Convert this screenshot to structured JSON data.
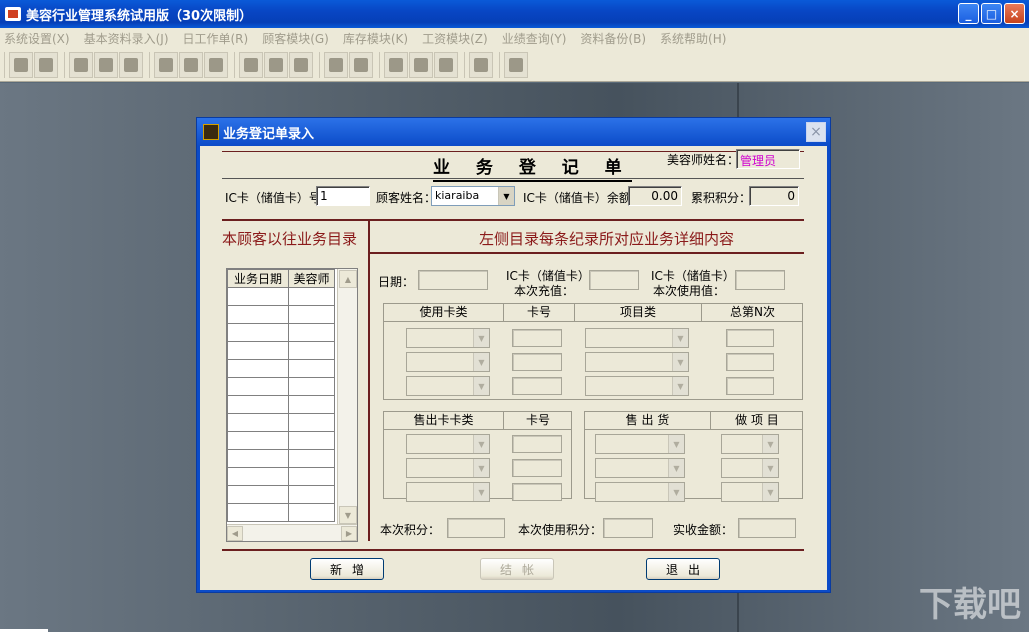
{
  "window": {
    "title": "美容行业管理系统试用版（30次限制）",
    "buttons": {
      "minimize": "_",
      "maximize": "□",
      "close": "×"
    }
  },
  "menu": [
    "系统设置(X)",
    "基本资料录入(J)",
    "日工作单(R)",
    "顾客模块(G)",
    "库存模块(K)",
    "工资模块(Z)",
    "业绩查询(Y)",
    "资料备份(B)",
    "系统帮助(H)"
  ],
  "toolbar_icons": [
    [
      "exit-icon",
      "lock-icon"
    ],
    [
      "handshake-icon",
      "edit-form-icon",
      "notebook-icon"
    ],
    [
      "binoculars-icon",
      "image-icon",
      "report-icon"
    ],
    [
      "transfer-icon",
      "register-icon",
      "keyboard-icon"
    ],
    [
      "card-icon",
      "ledger-icon"
    ],
    [
      "chart-icon",
      "calc-icon",
      "exchange-icon"
    ],
    [
      "phone-icon"
    ],
    [
      "tools-icon"
    ]
  ],
  "watermark": "下载吧",
  "dialog": {
    "title": "业务登记单录入",
    "form_title": "业 务 登 记 单",
    "beautician_label": "美容师姓名：",
    "beautician_value": "管理员",
    "ic_card_label": "IC卡（储值卡）号：",
    "ic_card_value": "1",
    "customer_label": "顾客姓名：",
    "customer_value": "kiaraiba",
    "balance_label": "IC卡（储值卡）余额：",
    "balance_value": "0.00",
    "points_label": "累积积分：",
    "points_value": "0",
    "left_heading": "本顾客以往业务目录",
    "right_heading": "左侧目录每条纪录所对应业务详细内容",
    "history_columns": [
      "业务日期",
      "美容师"
    ],
    "date_label": "日期：",
    "recharge_label_1": "IC卡（储值卡）",
    "recharge_label_2": "本次充值：",
    "use_label_1": "IC卡（储值卡）",
    "use_label_2": "本次使用值：",
    "grid1_columns": [
      "使用卡类",
      "卡号",
      "项目类",
      "总第N次"
    ],
    "grid2_columns": [
      "售出卡卡类",
      "卡号"
    ],
    "grid3_columns": [
      "售 出 货",
      "做 项 目"
    ],
    "this_points_label": "本次积分：",
    "used_points_label": "本次使用积分：",
    "received_label": "实收金额：",
    "btn_new": "新增",
    "btn_checkout": "结帐",
    "btn_exit": "退出",
    "close_glyph": "×"
  }
}
